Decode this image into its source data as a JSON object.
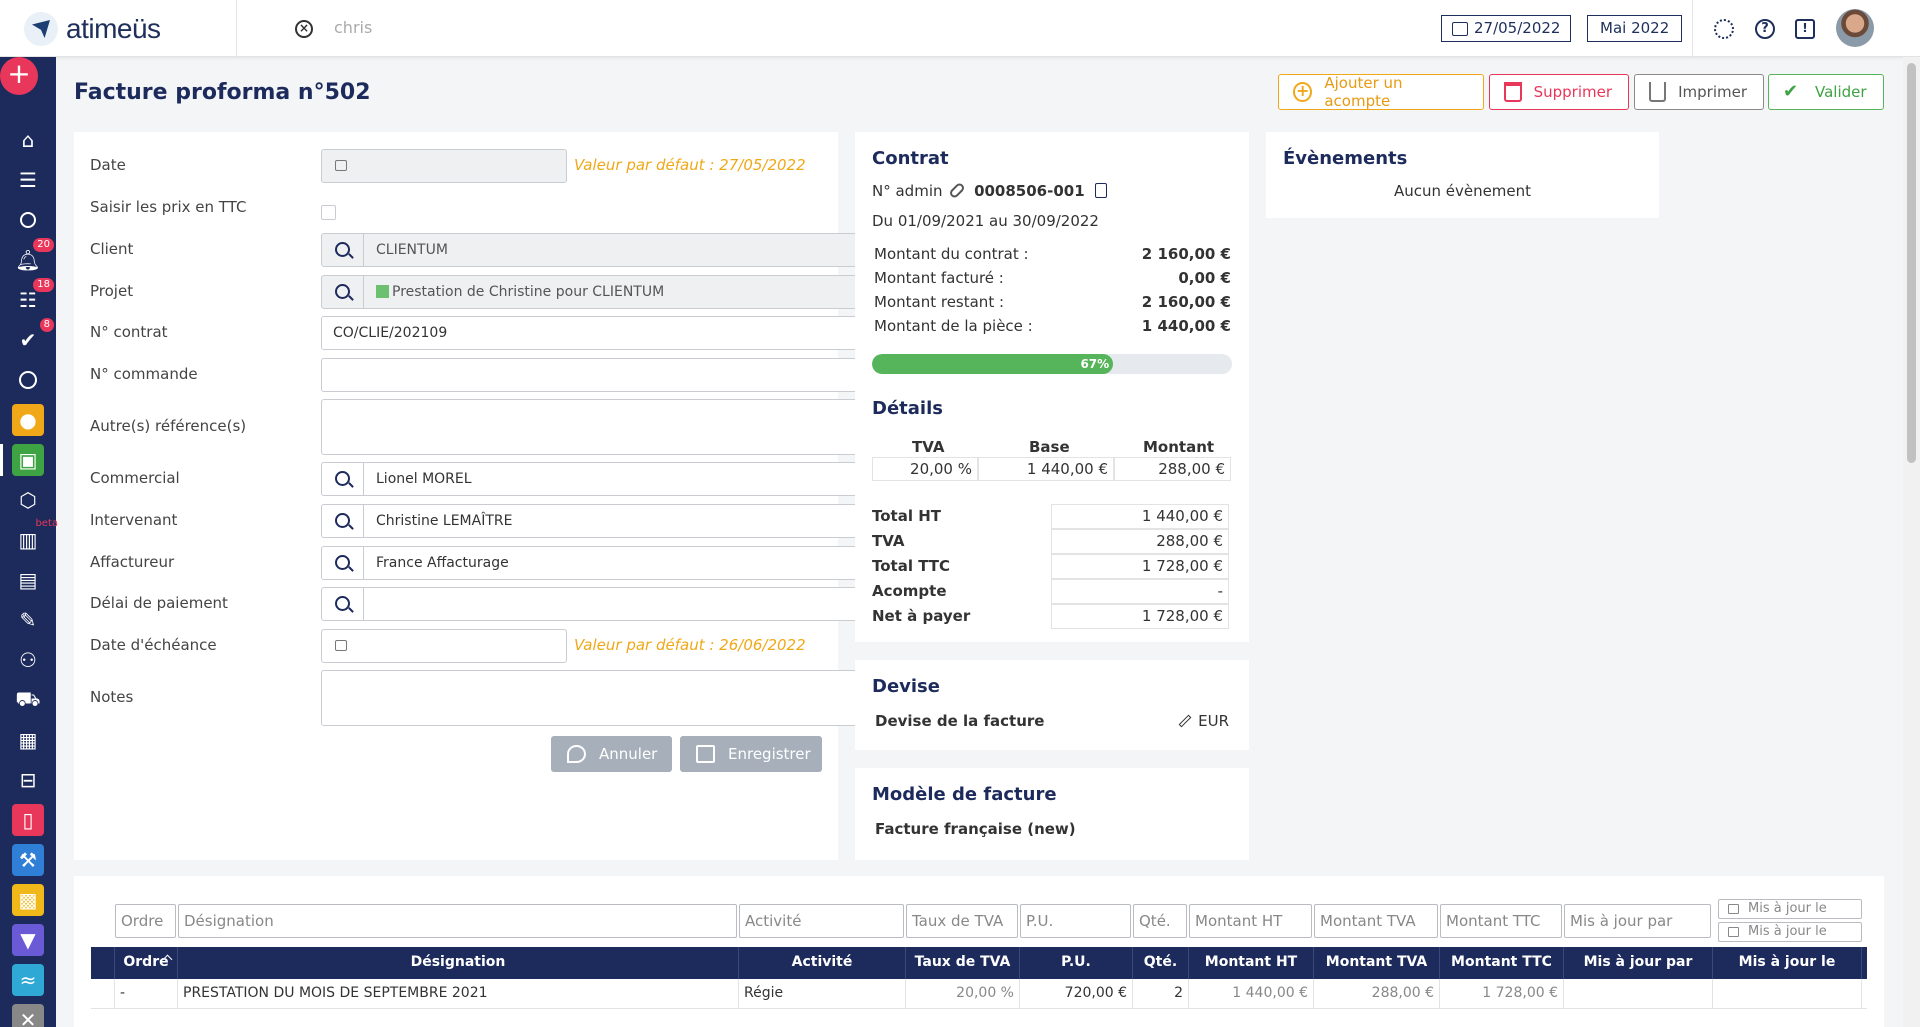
{
  "app": {
    "logo_text": "atimeüs"
  },
  "header": {
    "search_value": "chris",
    "current_date": "27/05/2022",
    "current_month": "Mai 2022"
  },
  "sidebar": {
    "badges": {
      "notifications": "20",
      "tasks": "18",
      "validations": "8"
    },
    "beta_label": "beta",
    "colors": {
      "background": "#1d2b5c",
      "add": "#e8375a"
    }
  },
  "page": {
    "title": "Facture proforma n°502",
    "actions": {
      "acompte": "Ajouter un acompte",
      "supprimer": "Supprimer",
      "imprimer": "Imprimer",
      "valider": "Valider"
    }
  },
  "form": {
    "labels": {
      "date": "Date",
      "ttc": "Saisir les prix en TTC",
      "client": "Client",
      "projet": "Projet",
      "contrat": "N° contrat",
      "commande": "N° commande",
      "references": "Autre(s) référence(s)",
      "commercial": "Commercial",
      "intervenant": "Intervenant",
      "affactureur": "Affactureur",
      "delai": "Délai de paiement",
      "echeance": "Date d'échéance",
      "notes": "Notes"
    },
    "values": {
      "date": "",
      "client": "CLIENTUM",
      "projet": "Prestation de Christine pour CLIENTUM",
      "contrat": "CO/CLIE/202109",
      "commande": "",
      "references": "",
      "commercial": "Lionel MOREL",
      "intervenant": "Christine LEMAÎTRE",
      "affactureur": "France Affacturage",
      "delai": "",
      "echeance": "",
      "notes": ""
    },
    "date_default": "Valeur par défaut : 27/05/2022",
    "echeance_default": "Valeur par défaut : 26/06/2022",
    "cancel_label": "Annuler",
    "save_label": "Enregistrer"
  },
  "contract": {
    "title": "Contrat",
    "admin_label": "N° admin",
    "admin_number": "0008506-001",
    "period": "Du 01/09/2021 au 30/09/2022",
    "rows": [
      {
        "label": "Montant du contrat :",
        "value": "2 160,00 €"
      },
      {
        "label": "Montant facturé :",
        "value": "0,00 €"
      },
      {
        "label": "Montant restant :",
        "value": "2 160,00 €"
      },
      {
        "label": "Montant de la pièce :",
        "value": "1 440,00 €"
      }
    ],
    "progress_label": "67%",
    "progress_fraction": 0.67
  },
  "details": {
    "title": "Détails",
    "vat_headers": [
      "TVA",
      "Base",
      "Montant"
    ],
    "vat_row": [
      "20,00 %",
      "1 440,00 €",
      "288,00 €"
    ],
    "totals": [
      {
        "label": "Total HT",
        "value": "1 440,00 €"
      },
      {
        "label": "TVA",
        "value": "288,00 €"
      },
      {
        "label": "Total TTC",
        "value": "1 728,00 €"
      },
      {
        "label": "Acompte",
        "value": "-"
      },
      {
        "label": "Net à payer",
        "value": "1 728,00 €"
      }
    ]
  },
  "devise": {
    "title": "Devise",
    "label": "Devise de la facture",
    "value": "EUR"
  },
  "model": {
    "title": "Modèle de facture",
    "value": "Facture française (new)"
  },
  "events": {
    "title": "Évènements",
    "empty": "Aucun évènement"
  },
  "table": {
    "filters": [
      "Ordre",
      "Désignation",
      "Activité",
      "Taux de TVA",
      "P.U.",
      "Qté.",
      "Montant HT",
      "Montant TVA",
      "Montant TTC",
      "Mis à jour par"
    ],
    "date_filters": [
      "Mis à jour le",
      "Mis à jour le"
    ],
    "headers": [
      "Ordre",
      "Désignation",
      "Activité",
      "Taux de TVA",
      "P.U.",
      "Qté.",
      "Montant HT",
      "Montant TVA",
      "Montant TTC",
      "Mis à jour par",
      "Mis à jour le"
    ],
    "rows": [
      [
        "-",
        "PRESTATION DU MOIS DE SEPTEMBRE 2021",
        "Régie",
        "20,00 %",
        "720,00 €",
        "2",
        "1 440,00 €",
        "288,00 €",
        "1 728,00 €",
        "",
        ""
      ]
    ]
  }
}
